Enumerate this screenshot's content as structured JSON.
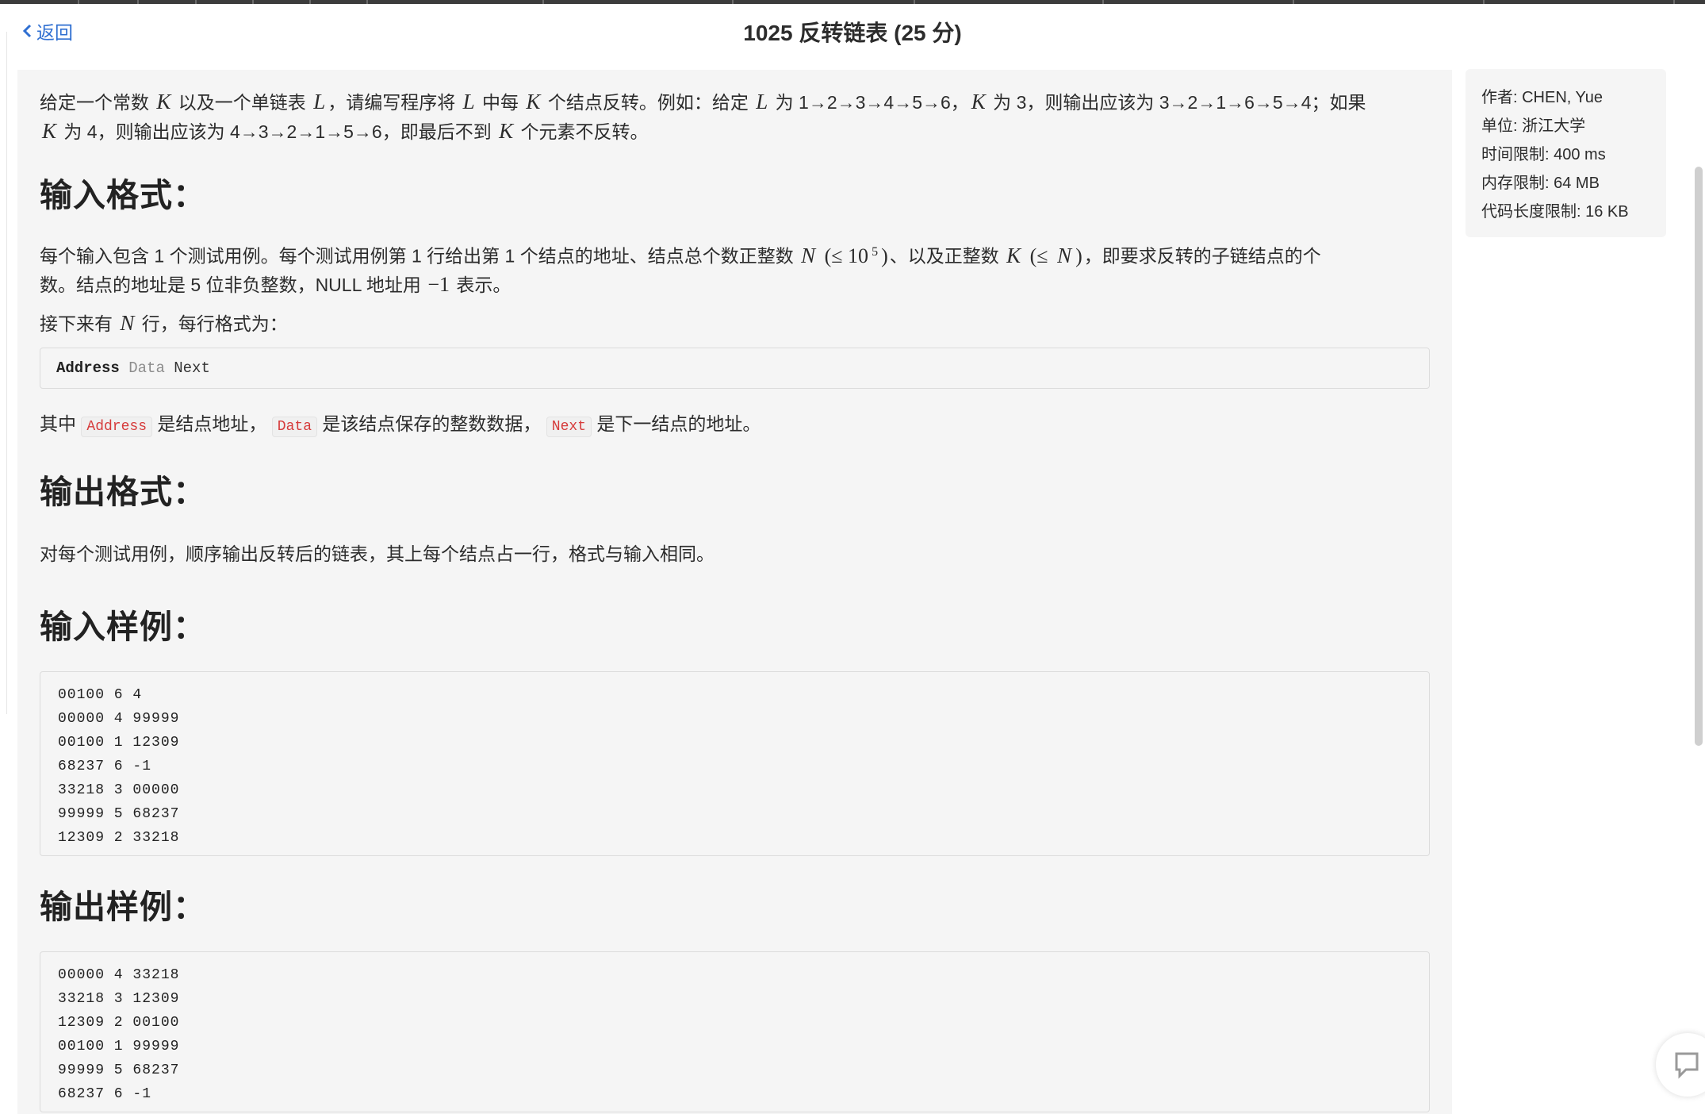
{
  "nav": {
    "back_label": "返回"
  },
  "problem": {
    "title": "1025 反转链表 (25 分)",
    "intro": {
      "t1": "给定一个常数 ",
      "K": "K",
      "t2": " 以及一个单链表 ",
      "L": "L",
      "t3": "，请编写程序将 ",
      "t4": " 中每 ",
      "t5": " 个结点反转。例如：给定 ",
      "t6": " 为 1→2→3→4→5→6，",
      "t7": " 为 3，则输出应该为 3→2→1→6→5→4；如果",
      "t8": " 为 4，则输出应该为 4→3→2→1→5→6，即最后不到 ",
      "t9": " 个元素不反转。"
    },
    "input_format": {
      "heading": "输入格式：",
      "t1": "每个输入包含 1 个测试用例。每个测试用例第 1 行给出第 1 个结点的地址、结点总个数正整数 ",
      "N": "N",
      "le1": " (≤ 10",
      "exp": "5",
      "le1b": ")",
      "t2": "、以及正整数 ",
      "le2": " (≤ ",
      "le2b": ")",
      "t3": "，即要求反转的子链结点的个",
      "t4": "数。结点的地址是 5 位非负整数，NULL 地址用 ",
      "neg": "−1",
      "t5": " 表示。",
      "t6": "接下来有 ",
      "t7": " 行，每行格式为：",
      "code_address": "Address",
      "code_data": "Data",
      "code_next": "Next",
      "t8": "其中 ",
      "t9": " 是结点地址， ",
      "t10": " 是该结点保存的整数数据， ",
      "t11": " 是下一结点的地址。"
    },
    "output_format": {
      "heading": "输出格式：",
      "text": "对每个测试用例，顺序输出反转后的链表，其上每个结点占一行，格式与输入相同。"
    },
    "sample_input": {
      "heading": "输入样例：",
      "lines": [
        "00100 6 4",
        "00000 4 99999",
        "00100 1 12309",
        "68237 6 -1",
        "33218 3 00000",
        "99999 5 68237",
        "12309 2 33218"
      ]
    },
    "sample_output": {
      "heading": "输出样例：",
      "lines": [
        "00000 4 33218",
        "33218 3 12309",
        "12309 2 00100",
        "00100 1 99999",
        "99999 5 68237",
        "68237 6 -1"
      ]
    }
  },
  "info": {
    "author": "作者: CHEN, Yue",
    "unit": "单位: 浙江大学",
    "time_limit": "时间限制: 400 ms",
    "memory_limit": "内存限制: 64 MB",
    "code_limit": "代码长度限制: 16 KB"
  }
}
